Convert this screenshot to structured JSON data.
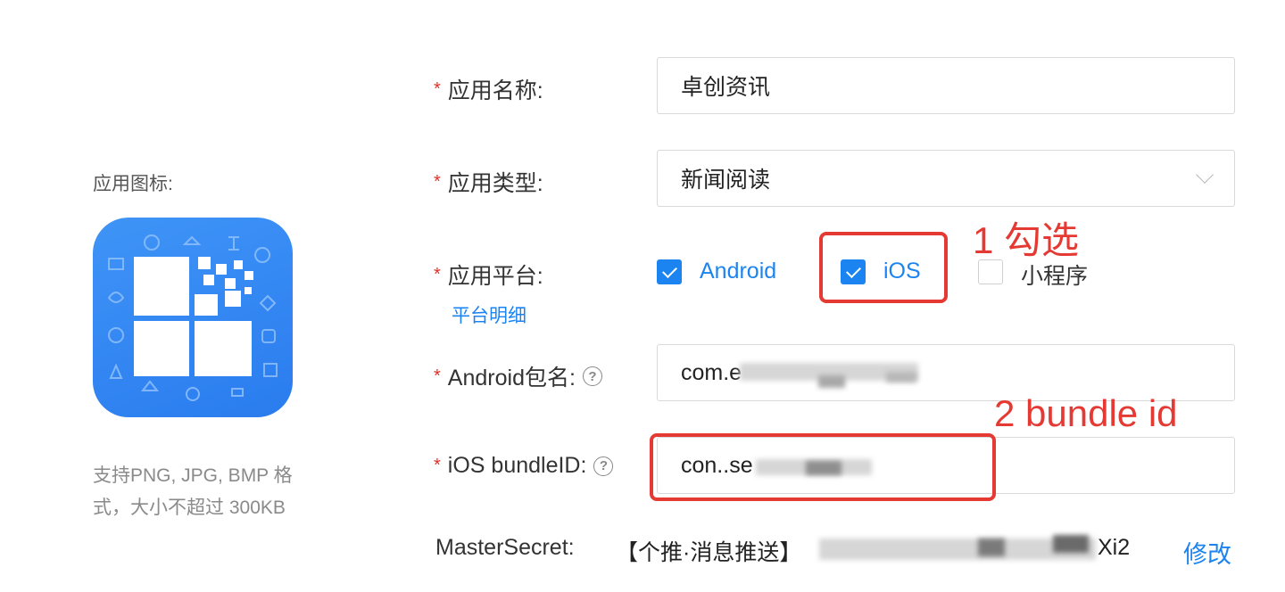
{
  "icon_section": {
    "label": "应用图标:",
    "hint": "支持PNG, JPG, BMP 格式，大小不超过 300KB"
  },
  "form": {
    "name": {
      "label": "应用名称:",
      "value": "卓创资讯"
    },
    "type": {
      "label": "应用类型:",
      "value": "新闻阅读"
    },
    "platform": {
      "label": "应用平台:",
      "details_link": "平台明细",
      "options": [
        {
          "label": "Android",
          "checked": true
        },
        {
          "label": "iOS",
          "checked": true
        },
        {
          "label": "小程序",
          "checked": false
        }
      ]
    },
    "android_package": {
      "label": "Android包名:",
      "value": "com.e"
    },
    "ios_bundle": {
      "label": "iOS bundleID:",
      "value": "con..se"
    },
    "master_secret": {
      "label": "MasterSecret:",
      "value": "【个推·消息推送】",
      "tail": "Xi2",
      "modify_link": "修改"
    }
  },
  "annotations": {
    "step1": "1 勾选",
    "step2": "2 bundle id"
  },
  "colors": {
    "accent": "#1c84f0",
    "annotation": "#e53a33",
    "required": "#e0302b"
  }
}
